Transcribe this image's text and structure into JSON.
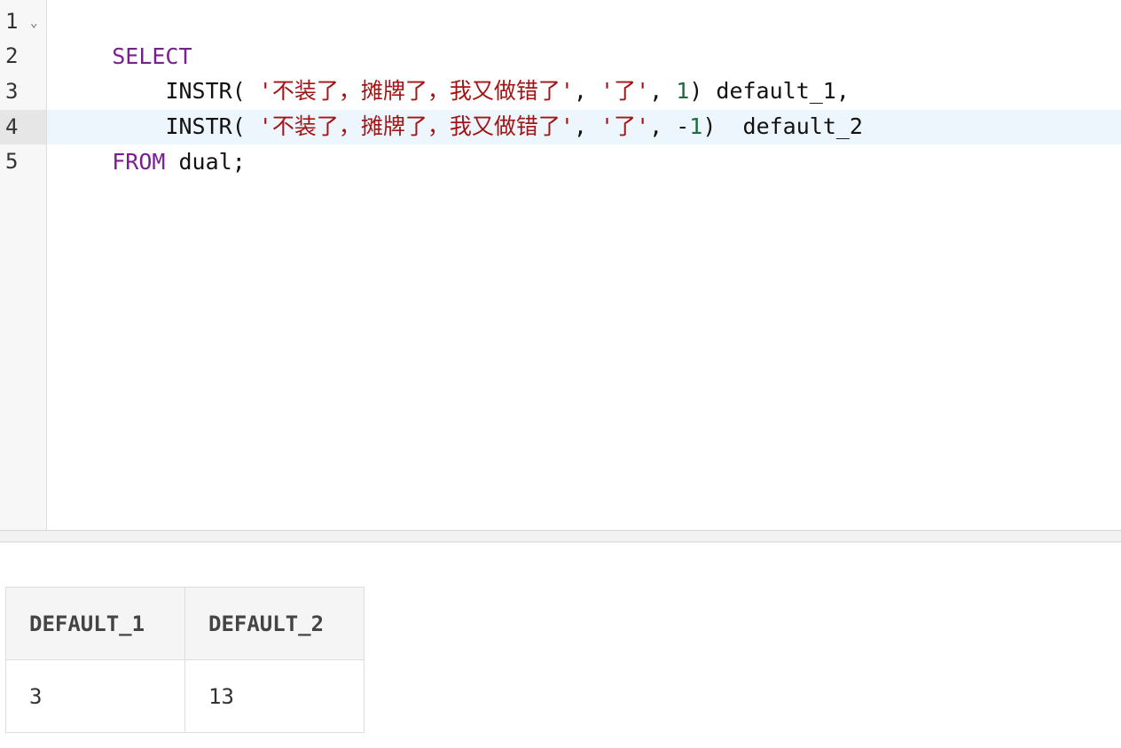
{
  "editor": {
    "line_numbers": [
      "1",
      "2",
      "3",
      "4",
      "5"
    ],
    "fold_icon": "⌄",
    "lines": {
      "l1": {
        "kw": "SELECT"
      },
      "l2": {
        "indent": "    ",
        "func": "INSTR( ",
        "str1": "'不装了，摊牌了，我又做错了'",
        "sep1": ", ",
        "str2": "'了'",
        "sep2": ", ",
        "num": "1",
        "rest": ") default_1,"
      },
      "l3": {
        "indent": "    ",
        "func": "INSTR( ",
        "str1": "'不装了，摊牌了，我又做错了'",
        "sep1": ", ",
        "str2": "'了'",
        "sep2": ", ",
        "minus": "-",
        "num": "1",
        "rest": ")  default_2"
      },
      "l4": {
        "kw": "FROM",
        "rest": " dual;"
      }
    },
    "colors": {
      "keyword": "#7a1f8f",
      "string": "#a31515",
      "number": "#1e6b3c",
      "active_line": "#eef6fd"
    }
  },
  "results": {
    "columns": [
      "DEFAULT_1",
      "DEFAULT_2"
    ],
    "rows": [
      [
        "3",
        "13"
      ]
    ]
  }
}
